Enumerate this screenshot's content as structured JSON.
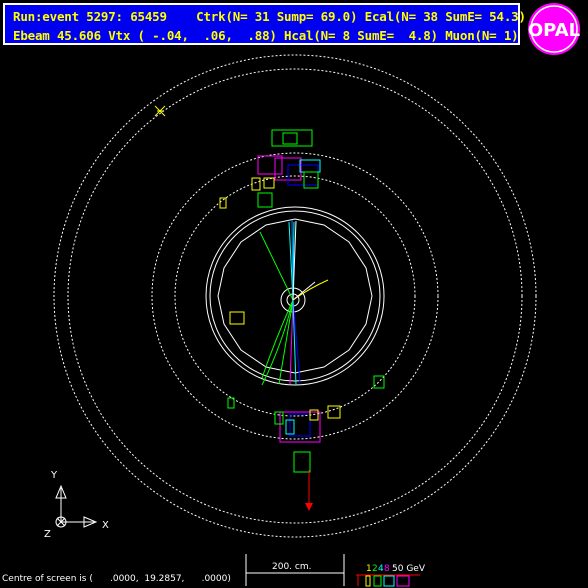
{
  "header": {
    "line1": "Run:event 5297: 65459    Ctrk(N= 31 Sump= 69.0) Ecal(N= 38 SumE= 54.3)",
    "line2": "Ebeam 45.606 Vtx ( -.04,  .06,  .88) Hcal(N= 8 SumE=  4.8) Muon(N= 1)",
    "bg_color": "#0000f0",
    "text_color": "#ffff00"
  },
  "logo": {
    "text": "OPAL",
    "color": "#ff00ff"
  },
  "axes": {
    "y_label": "Y",
    "x_label": "X",
    "z_label": "Z"
  },
  "scale_bar": {
    "label": "200. cm."
  },
  "energy_legend": {
    "values": [
      "1",
      "2",
      "4",
      "8",
      "50 GeV"
    ],
    "colors": [
      "#ffff00",
      "#00ff00",
      "#00ffff",
      "#ff00ff",
      "#ffffff"
    ]
  },
  "footer": {
    "centre_text": "Centre of screen is (      .0000,  19.2857,      .0000)"
  }
}
